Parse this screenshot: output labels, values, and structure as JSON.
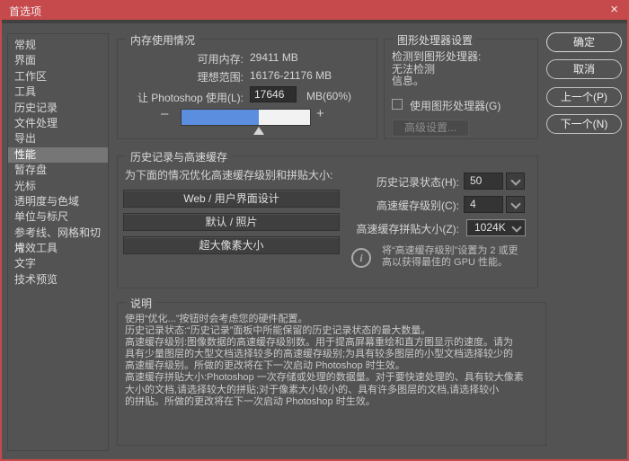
{
  "window": {
    "title": "首选项"
  },
  "icons": {
    "close_glyph": "×",
    "minus_glyph": "–",
    "plus_glyph": "+",
    "info_glyph": "i"
  },
  "sidebar": {
    "selected_index": 7,
    "items": [
      "常规",
      "界面",
      "工作区",
      "工具",
      "历史记录",
      "文件处理",
      "导出",
      "性能",
      "暂存盘",
      "光标",
      "透明度与色域",
      "单位与标尺",
      "参考线、网格和切片",
      "增效工具",
      "文字",
      "技术预览"
    ]
  },
  "memory": {
    "group_title": "内存使用情况",
    "available_label": "可用内存:",
    "available_value": "29411 MB",
    "ideal_label": "理想范围:",
    "ideal_value": "16176-21176 MB",
    "let_use_label": "让 Photoshop 使用(L):",
    "let_use_value": "17646",
    "let_use_suffix": "MB(60%)",
    "slider": {
      "percent": 60
    }
  },
  "gpu": {
    "group_title": "图形处理器设置",
    "detected_label": "检测到图形处理器:",
    "detected_value": "无法检测\n信息。",
    "use_gpu_label": "使用图形处理器(G)",
    "use_gpu_checked": false,
    "advanced_button": "高级设置..."
  },
  "actions": {
    "ok": "确定",
    "cancel": "取消",
    "prev": "上一个(P)",
    "next": "下一个(N)"
  },
  "history_cache": {
    "group_title": "历史记录与高速缓存",
    "optimize_label": "为下面的情况优化高速缓存级别和拼贴大小:",
    "preset_buttons": [
      "Web / 用户界面设计",
      "默认 / 照片",
      "超大像素大小"
    ],
    "history_states_label": "历史记录状态(H):",
    "history_states_value": "50",
    "cache_levels_label": "高速缓存级别(C):",
    "cache_levels_value": "4",
    "cache_tile_label": "高速缓存拼贴大小(Z):",
    "cache_tile_value": "1024K",
    "gpu_note": "将“高速缓存级别”设置为 2 或更\n高以获得最佳的 GPU 性能。"
  },
  "description": {
    "group_title": "说明",
    "text": "使用“优化...”按钮时会考虑您的硬件配置。\n历史记录状态:“历史记录”面板中所能保留的历史记录状态的最大数量。\n高速缓存级别:图像数据的高速缓存级别数。用于提高屏幕重绘和直方图显示的速度。请为\n具有少量图层的大型文档选择较多的高速缓存级别;为具有较多图层的小型文档选择较少的\n高速缓存级别。所做的更改将在下一次启动 Photoshop 时生效。\n高速缓存拼贴大小:Photoshop 一次存储或处理的数据量。对于要快速处理的、具有较大像素\n大小的文档,请选择较大的拼贴;对于像素大小较小的、具有许多图层的文档,请选择较小\n的拼贴。所做的更改将在下一次启动 Photoshop 时生效。"
  },
  "colors": {
    "accent_red": "#c64a4c",
    "dialog_bg": "#535353",
    "slider_blue": "#5b8ede"
  }
}
